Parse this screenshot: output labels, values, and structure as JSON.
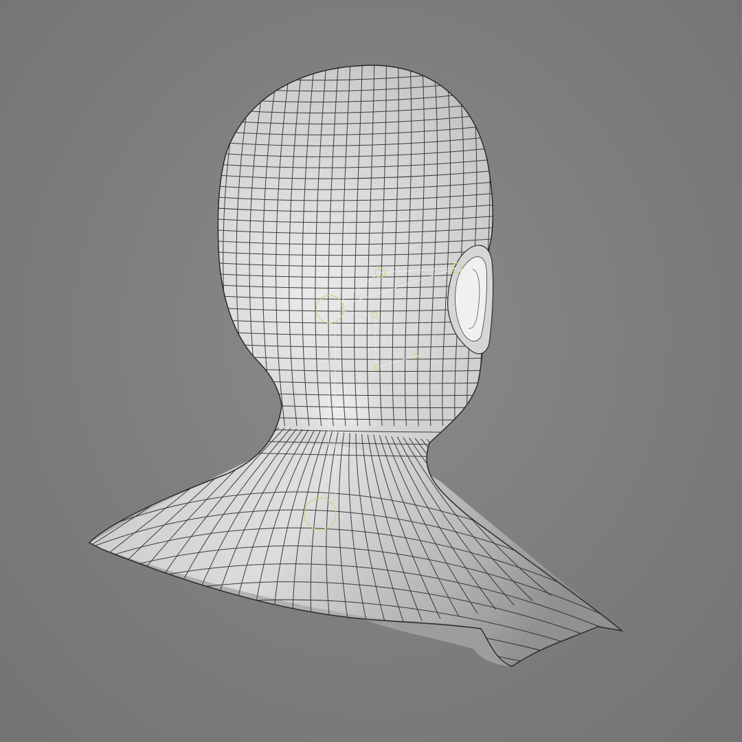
{
  "scene": {
    "object": "head-bust-mesh",
    "view": "perspective-back-three-quarter",
    "colors": {
      "background": "#7d7d7d",
      "mesh_fill": "#c4c4c4",
      "mesh_highlight": "#e4e4e4",
      "mesh_shadow": "#8e8e8e",
      "wireframe": "#1e1e1e",
      "rig_helpers": "#d8d080",
      "rig_links": "#eeeeee"
    }
  }
}
